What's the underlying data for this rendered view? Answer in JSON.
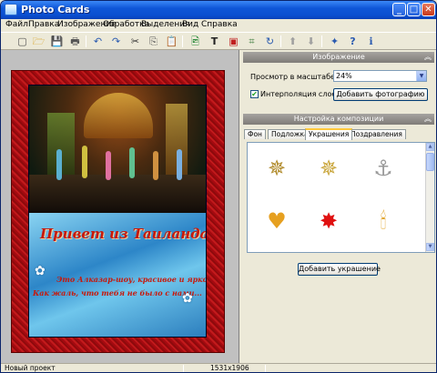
{
  "window": {
    "title": "Photo Cards",
    "controls": {
      "minimize": "_",
      "maximize": "□",
      "close": "✕"
    }
  },
  "menu": [
    "Файл",
    "Правка",
    "Изображение",
    "Обработка",
    "Выделения",
    "Вид",
    "Справка"
  ],
  "toolbar": {
    "tools": [
      "new-file-icon",
      "open-folder-icon",
      "save-icon",
      "print-icon",
      "undo-icon",
      "redo-icon",
      "cut-icon",
      "copy-icon",
      "paste-icon",
      "insert-image-icon",
      "text-icon",
      "frame-icon",
      "crop-icon",
      "rotate-icon",
      "arrow-up-icon",
      "arrow-down-icon",
      "fx-icon",
      "help-icon",
      "info-icon"
    ],
    "glyphs": [
      "▢",
      "🗁",
      "💾",
      "🖶",
      "↶",
      "↷",
      "✂",
      "⎘",
      "📋",
      "🖻",
      "T",
      "▣",
      "⌗",
      "↻",
      "⬆",
      "⬇",
      "✦",
      "?",
      "ℹ"
    ]
  },
  "card": {
    "greeting_title": "Привет из Таиланда!",
    "greeting_line1": "Это Алказар-шоу, красивое и яркое!",
    "greeting_line2": "Как жаль, что тебя не было с нами...",
    "frame_color": "#b0121a"
  },
  "image_panel": {
    "header": "Изображение",
    "zoom_label": "Просмотр в масштабе",
    "zoom_value": "24%",
    "interpolation_label": "Интерполяция слоев",
    "interpolation_checked": true,
    "add_photo_button": "Добавить фотографию"
  },
  "composition_panel": {
    "header": "Настройка композиции",
    "tabs": [
      "Фон",
      "Подложка",
      "Украшения",
      "Поздравления"
    ],
    "active_tab": "Украшения",
    "decorations": [
      {
        "icon": "gold-star-flower-icon",
        "glyph": "✵",
        "color": "#b08a2a"
      },
      {
        "icon": "gold-star-emerald-icon",
        "glyph": "✵",
        "color": "#c9a53a"
      },
      {
        "icon": "anchor-icon",
        "glyph": "⚓",
        "color": "#9a9a9a"
      },
      {
        "icon": "heart-balloon-icon",
        "glyph": "♥",
        "color": "#e6a020"
      },
      {
        "icon": "red-burst-icon",
        "glyph": "✸",
        "color": "#e01010"
      },
      {
        "icon": "candle-icon",
        "glyph": "🕯",
        "color": "#e0a020"
      }
    ],
    "add_decoration_button": "Добавить украшение"
  },
  "status": {
    "left": "Новый проект",
    "size": "1531x1906"
  }
}
